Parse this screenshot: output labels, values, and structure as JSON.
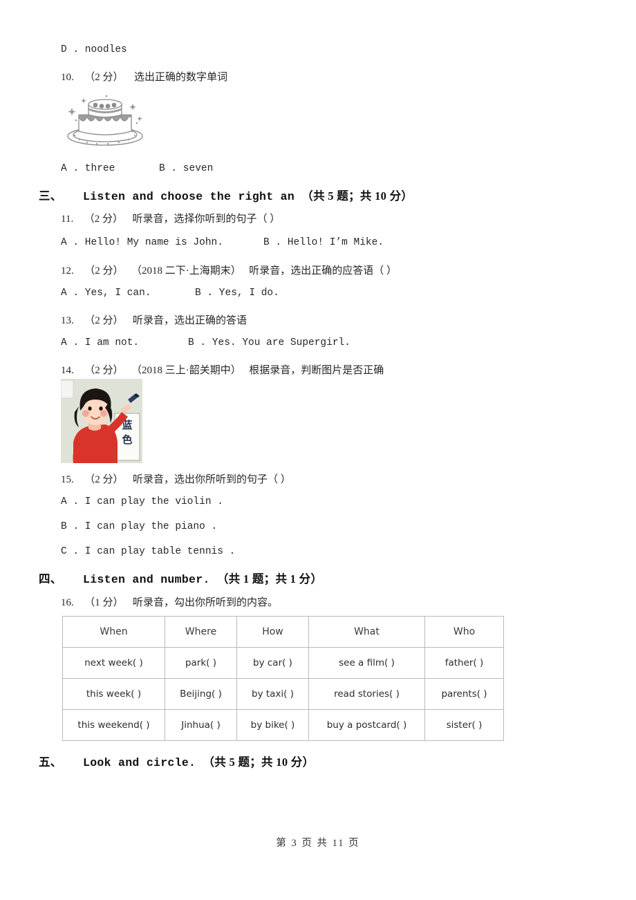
{
  "page": {
    "footer": "第 3 页 共 11 页"
  },
  "q10": {
    "prev_option_d": "D . noodles",
    "number": "10.",
    "score": "（2 分）",
    "prompt": "选出正确的数字单词",
    "image_name": "birthday-cake-illustration",
    "options": {
      "a": "A . three",
      "b": "B . seven"
    }
  },
  "section3": {
    "index": "三、",
    "title": "Listen and choose the right an",
    "meta": "（共 5 题；共 10 分）"
  },
  "q11": {
    "number": "11.",
    "score": "（2 分）",
    "prompt": "听录音，选择你听到的句子（      ）",
    "options": {
      "a": "A . Hello! My name is John.",
      "b": "B . Hello! I’m Mike."
    }
  },
  "q12": {
    "number": "12.",
    "score": "（2 分）",
    "source": "（2018 二下·上海期末）",
    "prompt": "听录音，选出正确的应答语（      ）",
    "options": {
      "a": "A . Yes, I can.",
      "b": "B . Yes, I do."
    }
  },
  "q13": {
    "number": "13.",
    "score": "（2 分）",
    "prompt": "听录音，选出正确的答语",
    "options": {
      "a": "A . I am not.",
      "b": "B . Yes. You are Supergirl."
    }
  },
  "q14": {
    "number": "14.",
    "score": "（2 分）",
    "source": "（2018 三上·韶关期中）",
    "prompt": "根据录音，判断图片是否正确",
    "image_name": "girl-pointing-at-blue-card-photo",
    "image_card_text": "蓝色"
  },
  "q15": {
    "number": "15.",
    "score": "（2 分）",
    "prompt": "听录音，选出你所听到的句子（      ）",
    "options": {
      "a": "A . I can play the violin .",
      "b": "B . I can play the piano .",
      "c": "C . I can play table tennis ."
    }
  },
  "section4": {
    "index": "四、",
    "title": "Listen and number.",
    "meta": "（共 1 题；共 1 分）"
  },
  "q16": {
    "number": "16.",
    "score": "（1 分）",
    "prompt": "听录音，勾出你所听到的内容。",
    "table": {
      "headers": [
        "When",
        "Where",
        "How",
        "What",
        "Who"
      ],
      "rows": [
        [
          "next week(   )",
          "park(   )",
          "by car(   )",
          "see a film(   )",
          "father(   )"
        ],
        [
          "this week(   )",
          "Beijing(   )",
          "by taxi(   )",
          "read stories(   )",
          "parents(   )"
        ],
        [
          "this weekend(   )",
          "Jinhua(   )",
          "by bike(   )",
          "buy a postcard(   )",
          "sister(   )"
        ]
      ]
    }
  },
  "section5": {
    "index": "五、",
    "title": "Look and circle.",
    "meta": "（共 5 题；共 10 分）"
  },
  "colors": {
    "text": "#262626",
    "table_border": "#b9b9b9",
    "girl_shirt": "#d8342a",
    "girl_hair": "#1b1513",
    "card_bg": "#f7f7f3"
  }
}
